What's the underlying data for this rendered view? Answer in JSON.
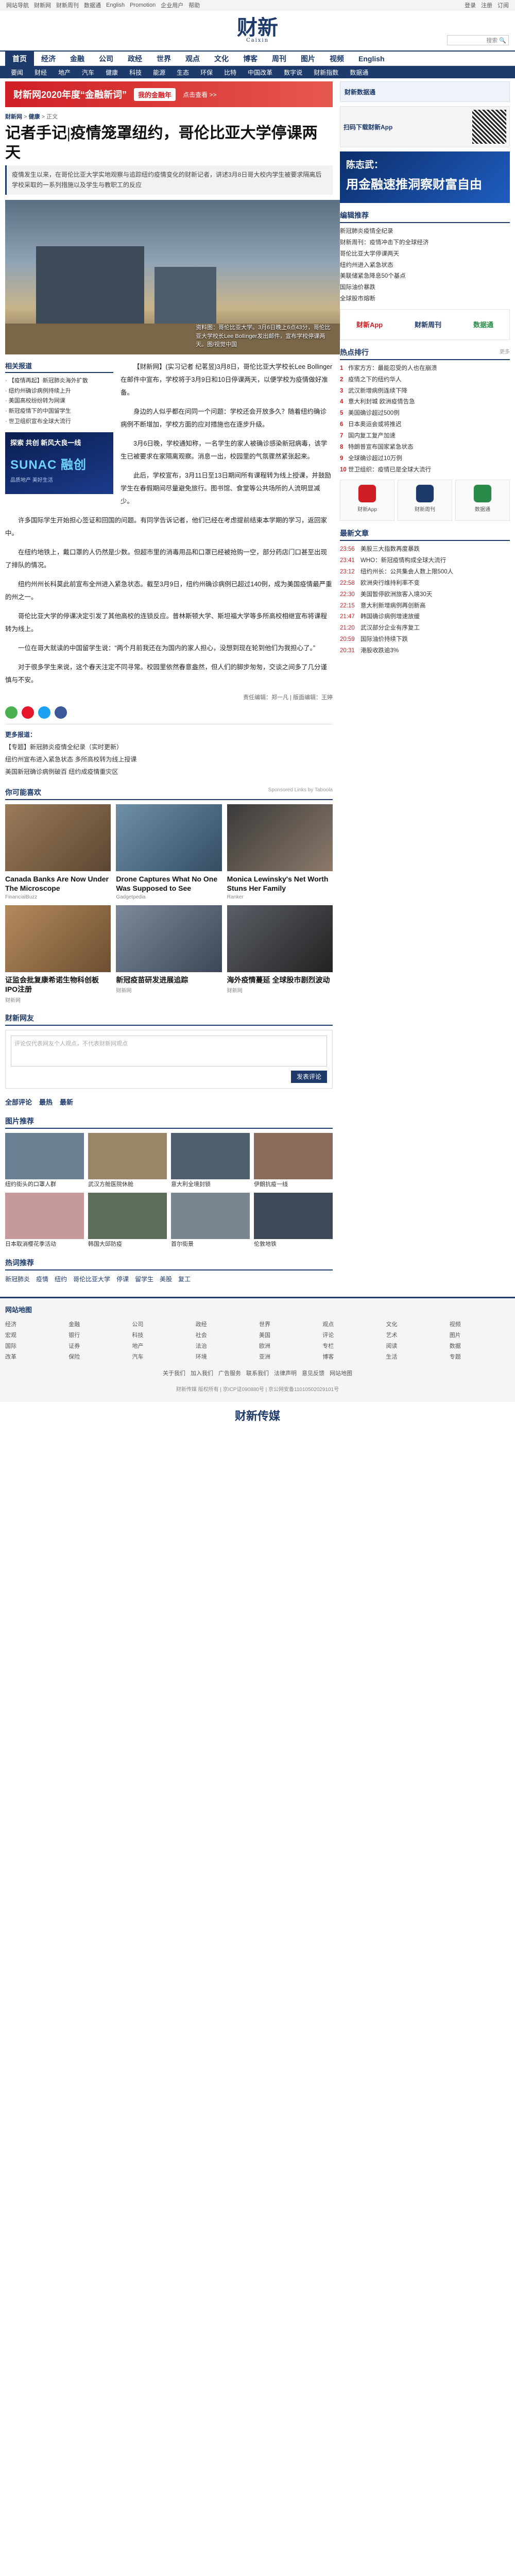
{
  "topbar": {
    "links": [
      "网站导航",
      "财新网",
      "财新周刊",
      "数据通",
      "English",
      "Promotion",
      "企业用户",
      "帮助"
    ],
    "right": [
      "登录",
      "注册",
      "订阅"
    ]
  },
  "masthead": {
    "logo": "财新",
    "logo_en": "Caixin",
    "right": [
      "登录",
      "注册",
      "订阅"
    ],
    "search_placeholder": "搜索"
  },
  "nav1": [
    "首页",
    "经济",
    "金融",
    "公司",
    "政经",
    "世界",
    "观点",
    "文化",
    "博客",
    "周刊",
    "图片",
    "视频",
    "English"
  ],
  "nav2": [
    "要闻",
    "财经",
    "地产",
    "汽车",
    "健康",
    "科技",
    "能源",
    "生态",
    "环保",
    "比特",
    "中国改革",
    "数字说",
    "财新指数",
    "数据通"
  ],
  "banner": {
    "b1": "财新网2020年度“金融新词”",
    "b2": "我的金融年",
    "b3": "点击查看 >>"
  },
  "crumb": {
    "pre": "财新网",
    "mid": "健康",
    "post": "正文"
  },
  "article": {
    "title": "记者手记|疫情笼罩纽约，哥伦比亚大学停课两天",
    "summary": "疫情发生以来，在哥伦比亚大学实地观察与追踪纽约疫情变化的财新记者，讲述3月8日哥大校内学生被要求隔离后学校采取的一系列措施以及学生与教职工的反应",
    "hero_caption": "资料图：哥伦比亚大学。3月6日晚上6点43分，哥伦比亚大学校长Lee Bollinger发出邮件，宣布学校停课两天。图/视觉中国",
    "author": "财新记者 纪茗昱 发自纽约",
    "paragraphs": [
      "【财新网】(实习记者 纪茗昱)3月8日，哥伦比亚大学校长Lee Bollinger在邮件中宣布，学校将于3月9日和10日停课两天，以便学校为疫情做好准备。",
      "身边的人似乎都在问同一个问题：学校还会开放多久？随着纽约确诊病例不断增加，学校方面的应对措施也在逐步升级。",
      "3月6日晚，学校通知称，一名学生的家人被确诊感染新冠病毒，该学生已被要求在家隔离观察。消息一出，校园里的气氛骤然紧张起来。",
      "此后，学校宣布，3月11日至13日期间所有课程转为线上授课，并鼓励学生在春假期间尽量避免旅行。图书馆、食堂等公共场所的人流明显减少。",
      "许多国际学生开始担心签证和回国的问题。有同学告诉记者，他们已经在考虑提前结束本学期的学习，返回家中。",
      "在纽约地铁上，戴口罩的人仍然是少数。但超市里的消毒用品和口罩已经被抢购一空，部分药店门口甚至出现了排队的情况。",
      "纽约州州长科莫此前宣布全州进入紧急状态。截至3月9日，纽约州确诊病例已超过140例，成为美国疫情最严重的州之一。",
      "哥伦比亚大学的停课决定引发了其他高校的连锁反应。普林斯顿大学、斯坦福大学等多所高校相继宣布将课程转为线上。",
      "一位在哥大就读的中国留学生说：“两个月前我还在为国内的家人担心，没想到现在轮到他们为我担心了。”",
      "对于很多学生来说，这个春天注定不同寻常。校园里依然春意盎然，但人们的脚步匆匆，交谈之间多了几分谨慎与不安。"
    ],
    "related_title": "更多报道：",
    "related": [
      "【专题】新冠肺炎疫情全纪录（实时更新）",
      "纽约州宣布进入紧急状态 多所高校转为线上授课",
      "美国新冠确诊病例破百 纽约成疫情重灾区"
    ],
    "editor": "责任编辑：郑一凡 | 版面编辑：王婷"
  },
  "leftcol": {
    "heading": "相关报道",
    "items": [
      "【疫情再起】新冠肺炎海外扩散",
      "纽约州确诊病例持续上升",
      "美国高校纷纷转为网课",
      "新冠疫情下的中国留学生",
      "世卫组织宣布全球大流行"
    ],
    "ad": {
      "t1": "探索 共创 新风大良一线",
      "t2": "SUNAC 融创",
      "t3": "品质地产 美好生活"
    }
  },
  "recommend": {
    "heading": "你可能喜欢",
    "sponsor": "Sponsored Links by Taboola",
    "cards": [
      {
        "t": "Canada Banks Are Now Under The Microscope",
        "s": "FinancialBuzz"
      },
      {
        "t": "Drone Captures What No One Was Supposed to See",
        "s": "Gadgetpedia"
      },
      {
        "t": "Monica Lewinsky's Net Worth Stuns Her Family",
        "s": "Ranker"
      },
      {
        "t": "证监会批复康希诺生物科创板IPO注册",
        "s": "财新网"
      },
      {
        "t": "新冠疫苗研发进展追踪",
        "s": "财新网"
      },
      {
        "t": "海外疫情蔓延 全球股市剧烈波动",
        "s": "财新网"
      }
    ]
  },
  "comment": {
    "heading": "财新网友",
    "placeholder": "评论仅代表网友个人观点，不代表财新网观点",
    "button": "发表评论"
  },
  "tabs": [
    "全部评论",
    "最热",
    "最新"
  ],
  "pics": {
    "heading": "图片推荐",
    "items": [
      "纽约街头的口罩人群",
      "武汉方舱医院休舱",
      "意大利全境封锁",
      "伊朗抗疫一线",
      "日本取消樱花季活动",
      "韩国大邱防疫",
      "首尔街景",
      "伦敦地铁"
    ]
  },
  "sidebar": {
    "ad1": "财新数据通",
    "ad2": "扫码下载财新App",
    "ad3": {
      "l1": "陈志武：",
      "l2": "用金融速推洞察财富自由"
    },
    "editor_pick": {
      "h": "编辑推荐",
      "items": [
        "新冠肺炎疫情全纪录",
        "财新周刊：疫情冲击下的全球经济",
        "哥伦比亚大学停课两天",
        "纽约州进入紧急状态",
        "美联储紧急降息50个基点",
        "国际油价暴跌",
        "全球股市熔断"
      ]
    },
    "rank": {
      "h": "热点排行",
      "more": "更多",
      "items": [
        "作家方方：最能忍受的人也在崩溃",
        "疫情之下的纽约华人",
        "武汉新增病例连续下降",
        "意大利封城 欧洲疫情告急",
        "美国确诊超过500例",
        "日本奥运会或将推迟",
        "国内复工复产加速",
        "特朗普宣布国家紧急状态",
        "全球确诊超过10万例",
        "世卫组织：疫情已是全球大流行"
      ]
    },
    "app": [
      "财新App",
      "财新周刊",
      "数据通"
    ],
    "latest": {
      "h": "最新文章",
      "items": [
        {
          "tm": "23:56",
          "t": "美股三大指数再度暴跌"
        },
        {
          "tm": "23:41",
          "t": "WHO：新冠疫情构成全球大流行"
        },
        {
          "tm": "23:12",
          "t": "纽约州长：公共集会人数上限500人"
        },
        {
          "tm": "22:58",
          "t": "欧洲央行维持利率不变"
        },
        {
          "tm": "22:30",
          "t": "美国暂停欧洲旅客入境30天"
        },
        {
          "tm": "22:15",
          "t": "意大利新增病例再创新高"
        },
        {
          "tm": "21:47",
          "t": "韩国确诊病例增速放缓"
        },
        {
          "tm": "21:20",
          "t": "武汉部分企业有序复工"
        },
        {
          "tm": "20:59",
          "t": "国际油价持续下跌"
        },
        {
          "tm": "20:31",
          "t": "港股收跌逾3%"
        }
      ]
    }
  },
  "hotlinks": {
    "h": "热词推荐",
    "items": [
      "新冠肺炎",
      "疫情",
      "纽约",
      "哥伦比亚大学",
      "停课",
      "留学生",
      "美股",
      "复工"
    ]
  },
  "footer": {
    "h": "网站地图",
    "cols": [
      [
        "经济",
        "宏观",
        "国际",
        "改革"
      ],
      [
        "金融",
        "银行",
        "证券",
        "保险"
      ],
      [
        "公司",
        "科技",
        "地产",
        "汽车"
      ],
      [
        "政经",
        "社会",
        "法治",
        "环境"
      ],
      [
        "世界",
        "美国",
        "欧洲",
        "亚洲"
      ],
      [
        "观点",
        "评论",
        "专栏",
        "博客"
      ],
      [
        "文化",
        "艺术",
        "阅读",
        "生活"
      ],
      [
        "视频",
        "图片",
        "数据",
        "专题"
      ]
    ],
    "links": [
      "关于我们",
      "加入我们",
      "广告服务",
      "联系我们",
      "法律声明",
      "意见反馈",
      "网站地图"
    ],
    "copy": "财新传媒 版权所有 | 京ICP证090880号 | 京公网安备11010502029101号",
    "bottom": "财新传媒"
  },
  "colors": {
    "brand": "#1d3a6b",
    "accent": "#cf1f25"
  }
}
